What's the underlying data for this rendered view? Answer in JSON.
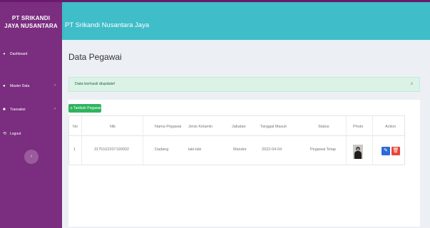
{
  "app": {
    "brand_line1": "PT SRIKANDI",
    "brand_line2": "JAYA NUSANTARA",
    "header_title": "PT Srikandi Nusantara Jaya"
  },
  "sidebar": {
    "items": [
      {
        "label": "Dashboard",
        "icon": "dashboard-icon"
      },
      {
        "label": "Master Data",
        "icon": "user-icon"
      },
      {
        "label": "Transaksi",
        "icon": "transaction-icon"
      },
      {
        "label": "Logout",
        "icon": "logout-icon"
      }
    ]
  },
  "page": {
    "title": "Data Pegawai",
    "alert_text": "Data berhasil diupdate!",
    "alert_close": "x",
    "add_button": "Tambah Pegawai"
  },
  "table": {
    "headers": [
      "No",
      "Nik",
      "Nama Pegawai",
      "Jenis Kelamin",
      "Jabatan",
      "Tanggal Masuk",
      "Status",
      "Photo",
      "Action"
    ],
    "rows": [
      {
        "no": "1",
        "nik": "3175102207190002",
        "nama": "Dadang",
        "jk": "laki-laki",
        "jabatan": "Mandor",
        "tgl": "2022-04-04",
        "status": "Pegawai Tetap"
      }
    ]
  },
  "colors": {
    "sidebar": "#7b2d7f",
    "header": "#3fbdc8",
    "alert": "#dbf3e7",
    "add": "#2fb45e",
    "edit": "#2c6bd8",
    "delete": "#e8453c"
  }
}
